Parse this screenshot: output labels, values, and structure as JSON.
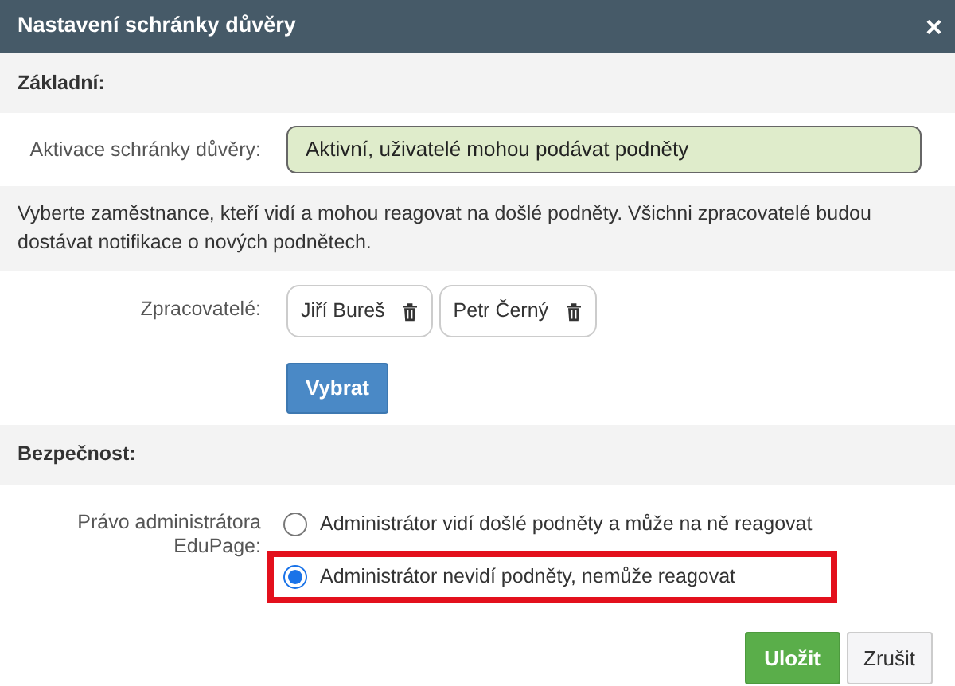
{
  "window": {
    "title": "Nastavení schránky důvěry",
    "close": "×"
  },
  "sections": [
    {
      "kind": "heading",
      "text": "Základní:"
    },
    {
      "kind": "select",
      "label": "Aktivace schránky důvěry:",
      "value": "Aktivní, uživatelé mohou podávat podněty"
    },
    {
      "kind": "note",
      "text": "Vyberte zaměstnance, kteří vidí a mohou reagovat na došlé podněty. Všichni zpracovatelé budou dostávat notifikace o nových podnětech."
    },
    {
      "kind": "people",
      "label": "Zpracovatelé:",
      "people": [
        "Jiří Bureš",
        "Petr Černý"
      ],
      "button": "Vybrat"
    },
    {
      "kind": "heading",
      "text": "Bezpečnost:"
    },
    {
      "kind": "radios",
      "label": "Právo administrátora EduPage:",
      "options": [
        {
          "label": "Administrátor vidí došlé podněty a může na ně reagovat",
          "selected": false,
          "highlighted": false
        },
        {
          "label": "Administrátor nevidí podněty, nemůže reagovat",
          "selected": true,
          "highlighted": true
        }
      ]
    }
  ],
  "buttons": [
    {
      "label": "Uložit",
      "kind": "primary"
    },
    {
      "label": "Zrušit",
      "kind": "secondary"
    }
  ]
}
